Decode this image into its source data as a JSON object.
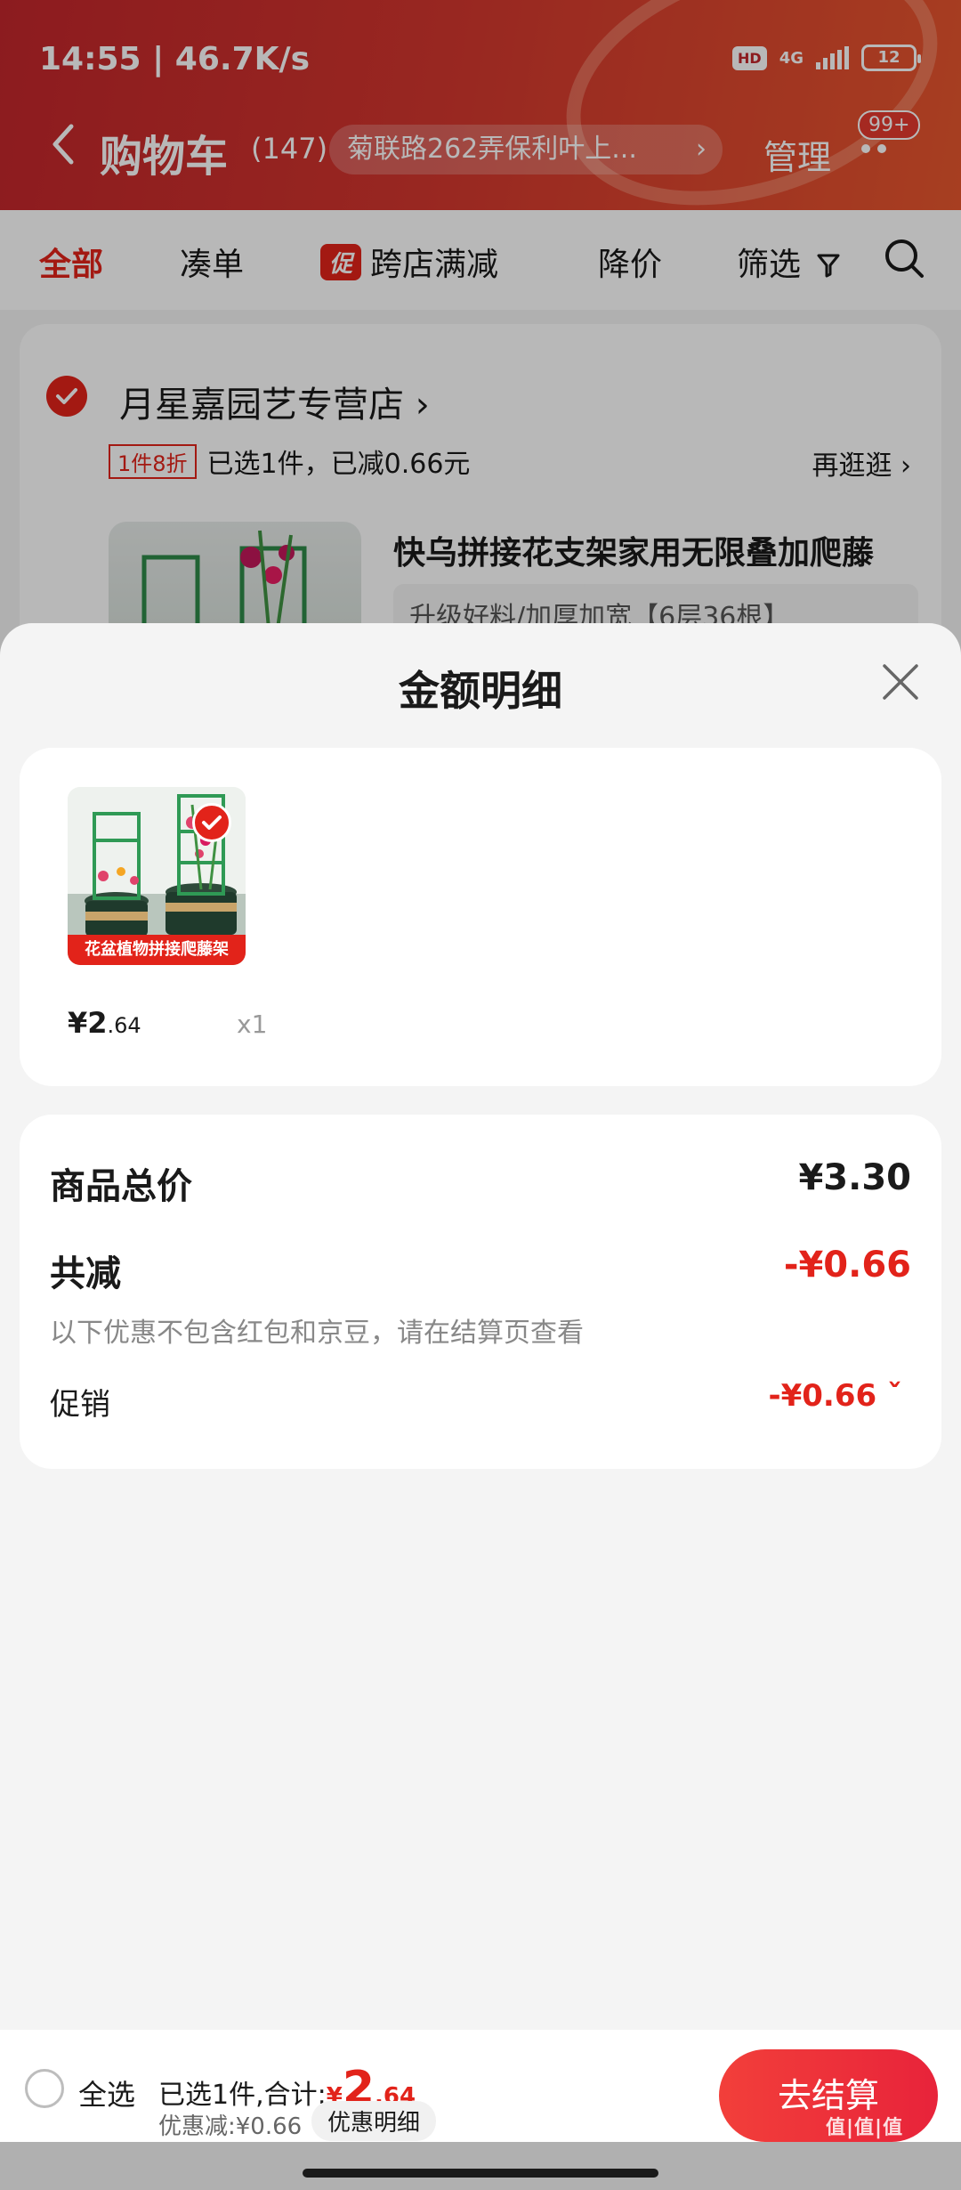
{
  "status": {
    "time": "14:55 | 46.7K/s",
    "hd": "HD",
    "network": "4G",
    "battery": "12"
  },
  "header": {
    "title": "购物车",
    "count": "(147)",
    "address": "菊联路262弄保利叶上...",
    "address_chevron": "›",
    "manage": "管理",
    "badge": "99+"
  },
  "tabs": [
    {
      "label": "全部"
    },
    {
      "label": "凑单"
    },
    {
      "promo_tag": "促",
      "label": "跨店满减"
    },
    {
      "label": "降价"
    },
    {
      "label": "筛选"
    }
  ],
  "store": {
    "name": "月星嘉园艺专营店 ›",
    "discount_tag": "1件8折",
    "promo_text": "已选1件，已减0.66元",
    "revisit": "再逛逛 ›",
    "product_title": "快乌拼接花支架家用无限叠加爬藤",
    "spec": "升级好料/加厚加宽【6层36根】"
  },
  "sheet": {
    "title": "金额明细",
    "item": {
      "caption": "花盆植物拼接爬藤架",
      "price_int": "¥2",
      "price_dec": ".64",
      "qty": "x1"
    },
    "summary": {
      "total_label": "商品总价",
      "total_value": "¥3.30",
      "reduce_label": "共减",
      "reduce_value": "-¥0.66",
      "note": "以下优惠不包含红包和京豆，请在结算页查看",
      "promo_label": "促销",
      "promo_value": "-¥0.66 ˇ"
    }
  },
  "bottom": {
    "select_all": "全选",
    "selected_prefix": "已选1件,合计:",
    "total_yen": "¥",
    "total_int": "2",
    "total_dec": ".64",
    "saved": "优惠减:¥0.66",
    "detail_button": "优惠明细",
    "checkout": "去结算"
  },
  "watermark": "值|值|值",
  "colors": {
    "brand_red": "#e2231a",
    "header_start": "#c3262b",
    "header_end": "#e8572f"
  }
}
